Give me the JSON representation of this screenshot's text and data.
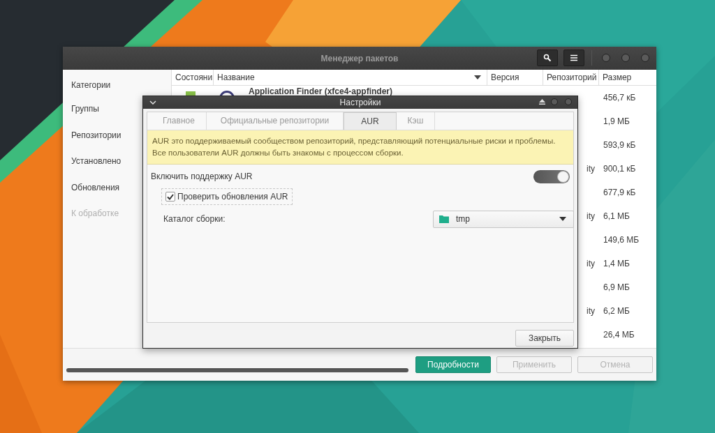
{
  "main_window": {
    "title": "Менеджер пакетов",
    "sidebar": {
      "items": [
        {
          "label": "Категории",
          "disabled": false
        },
        {
          "label": "Группы",
          "disabled": false
        },
        {
          "label": "Репозитории",
          "disabled": false
        },
        {
          "label": "Установлено",
          "disabled": false
        },
        {
          "label": "Обновления",
          "disabled": false
        },
        {
          "label": "К обработке",
          "disabled": true
        }
      ]
    },
    "table": {
      "columns": [
        "Состояни",
        "Название",
        "Версия",
        "Репозиторий",
        "Размер"
      ],
      "rows": [
        {
          "name": "Application Finder (xfce4-appfinder)",
          "size": "456,7 кБ"
        },
        {
          "size": "1,9 МБ"
        },
        {
          "size": "593,9 кБ"
        },
        {
          "repository": "ity",
          "size": "900,1 кБ"
        },
        {
          "size": "677,9 кБ"
        },
        {
          "repository": "ity",
          "size": "6,1 МБ"
        },
        {
          "size": "149,6 МБ"
        },
        {
          "repository": "ity",
          "size": "1,4 МБ"
        },
        {
          "size": "6,9 МБ"
        },
        {
          "repository": "ity",
          "size": "6,2 МБ"
        },
        {
          "size": "26,4 МБ"
        }
      ]
    },
    "buttons": [
      {
        "label": "Подробности",
        "kind": "primary",
        "disabled": false
      },
      {
        "label": "Применить",
        "kind": "normal",
        "disabled": true
      },
      {
        "label": "Отмена",
        "kind": "normal",
        "disabled": true
      }
    ]
  },
  "dialog": {
    "title": "Настройки",
    "tabs": [
      {
        "label": "Главное",
        "selected": false
      },
      {
        "label": "Официальные репозитории",
        "selected": false
      },
      {
        "label": "AUR",
        "selected": true
      },
      {
        "label": "Кэш",
        "selected": false
      }
    ],
    "info": [
      "AUR это поддерживаемый сообществом репозиторий, представляющий потенциальные риски и проблемы.",
      "Все пользователи AUR должны быть знакомы с процессом сборки."
    ],
    "enable_aur": {
      "label": "Включить поддержку AUR",
      "on": true
    },
    "check_updates": {
      "label": "Проверить обновления AUR",
      "checked": true
    },
    "build_dir": {
      "label": "Каталог сборки:",
      "value": "tmp"
    },
    "close_button": "Закрыть"
  }
}
